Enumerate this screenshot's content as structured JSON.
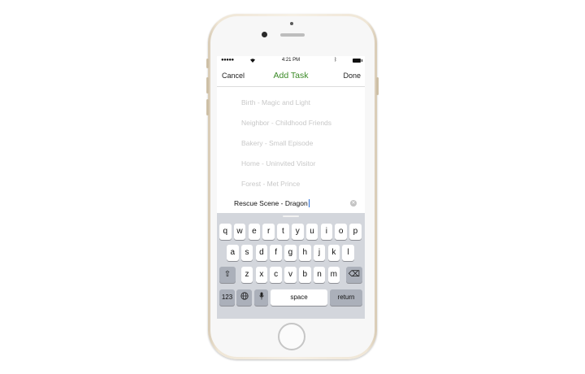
{
  "status_bar": {
    "signal": "●●●●●",
    "wifi_icon": "wifi-icon",
    "time": "4:21 PM",
    "bluetooth_icon": "bluetooth-icon",
    "battery_icon": "battery-icon"
  },
  "navbar": {
    "cancel_label": "Cancel",
    "title": "Add Task",
    "done_label": "Done",
    "title_color": "#3b8a27"
  },
  "suggestions": [
    "Birth - Magic and Light",
    "Neighbor - Childhood Friends",
    "Bakery - Small Episode",
    "Home - Uninvited Visitor",
    "Forest - Met Prince"
  ],
  "task_input": {
    "value": "Rescue Scene - Dragon"
  },
  "keyboard": {
    "row1": [
      "q",
      "w",
      "e",
      "r",
      "t",
      "y",
      "u",
      "i",
      "o",
      "p"
    ],
    "row2": [
      "a",
      "s",
      "d",
      "f",
      "g",
      "h",
      "j",
      "k",
      "l"
    ],
    "row3": [
      "z",
      "x",
      "c",
      "v",
      "b",
      "n",
      "m"
    ],
    "shift_icon": "⇧",
    "delete_icon": "⌫",
    "numbers_label": "123",
    "globe_icon": "🌐",
    "mic_icon": "🎤",
    "space_label": "space",
    "return_label": "return"
  }
}
